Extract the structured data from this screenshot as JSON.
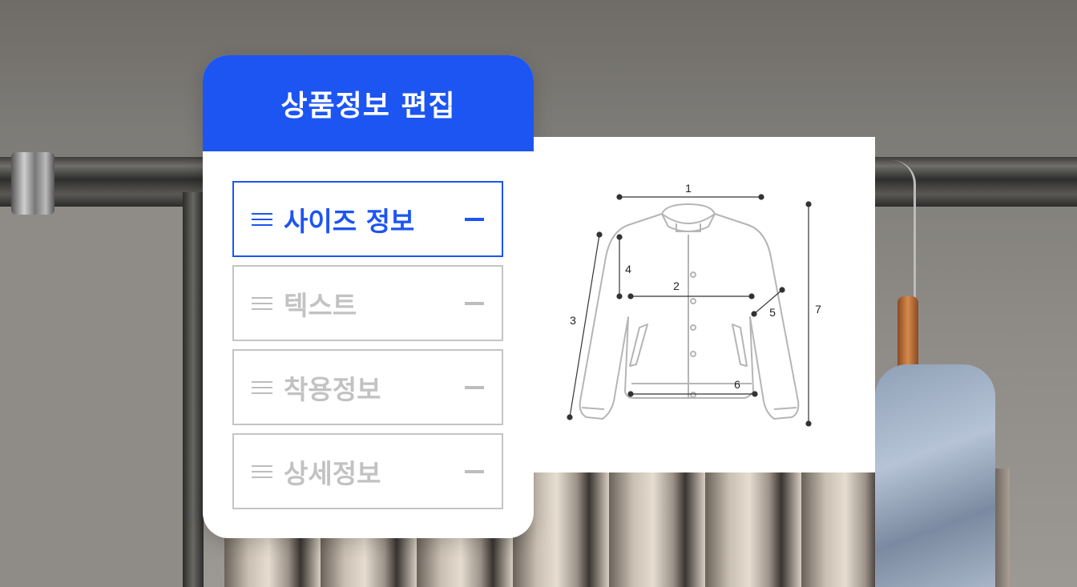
{
  "panel": {
    "title": "상품정보 편집",
    "items": [
      {
        "label": "사이즈 정보",
        "active": true
      },
      {
        "label": "텍스트",
        "active": false
      },
      {
        "label": "착용정보",
        "active": false
      },
      {
        "label": "상세정보",
        "active": false
      }
    ]
  },
  "size_chart": {
    "labels": [
      "1",
      "2",
      "3",
      "4",
      "5",
      "6",
      "7"
    ]
  },
  "colors": {
    "accent": "#1d55f2",
    "inactive": "#c2c2c2"
  }
}
